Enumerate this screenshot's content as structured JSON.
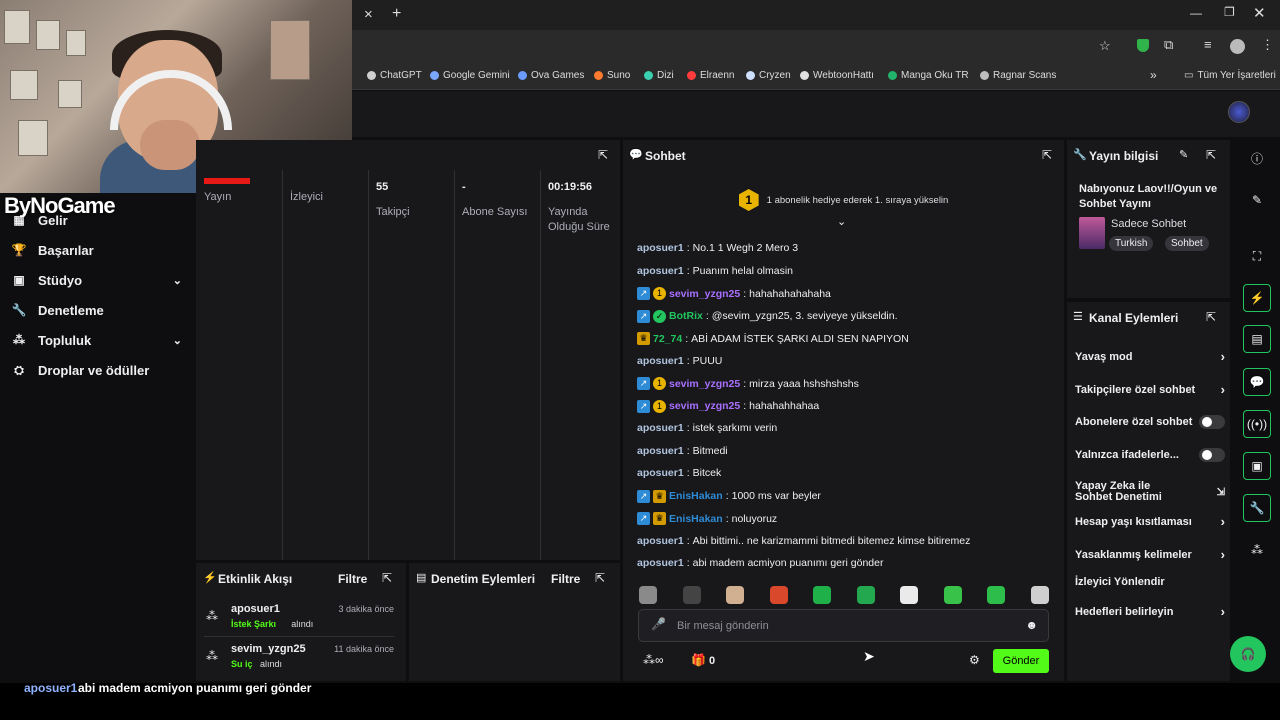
{
  "browser": {
    "close_tab": "×",
    "new_tab": "+",
    "bookmarks": [
      {
        "label": "ChatGPT",
        "color": "#cfcfcf"
      },
      {
        "label": "Google Gemini",
        "color": "#7aa7ff"
      },
      {
        "label": "Ova Games",
        "color": "#6c9cff"
      },
      {
        "label": "Suno",
        "color": "#ff7a2f"
      },
      {
        "label": "Dizi",
        "color": "#3ad0b0"
      },
      {
        "label": "Elraenn",
        "color": "#ff3b3b"
      },
      {
        "label": "Cryzen",
        "color": "#cfe0ff"
      },
      {
        "label": "WebtoonHattı",
        "color": "#e0e0e0"
      },
      {
        "label": "Manga Oku TR",
        "color": "#23b26b"
      },
      {
        "label": "Ragnar Scans",
        "color": "#bdbdbd"
      }
    ],
    "more": "»",
    "all_bookmarks": "Tüm Yer İşaretleri"
  },
  "brand": "ByNoGame",
  "sidebar": {
    "items": [
      {
        "label": "Gelir",
        "icon": "money-icon"
      },
      {
        "label": "Başarılar",
        "icon": "trophy-icon"
      },
      {
        "label": "Stüdyo",
        "icon": "studio-icon",
        "expandable": true
      },
      {
        "label": "Denetleme",
        "icon": "wrench-icon"
      },
      {
        "label": "Topluluk",
        "icon": "community-icon",
        "expandable": true
      },
      {
        "label": "Droplar ve ödüller",
        "icon": "gift-icon"
      }
    ]
  },
  "stats": {
    "columns": [
      {
        "value": "",
        "label": "Yayın"
      },
      {
        "value": "",
        "label": "İzleyici"
      },
      {
        "value": "55",
        "label": "Takipçi"
      },
      {
        "value": "-",
        "label": "Abone Sayısı"
      },
      {
        "value": "00:19:56",
        "label": "Yayında Olduğu Süre"
      }
    ]
  },
  "activity": {
    "title": "Etkinlik Akışı",
    "filter": "Filtre",
    "items": [
      {
        "user": "aposuer1",
        "time": "3 dakika önce",
        "reward": "İstek Şarkı",
        "suffix": "alındı"
      },
      {
        "user": "sevim_yzgn25",
        "time": "11 dakika önce",
        "reward": "Su iç",
        "suffix": "alındı"
      }
    ]
  },
  "modlog": {
    "title": "Denetim Eylemleri",
    "filter": "Filtre"
  },
  "chat": {
    "title": "Sohbet",
    "hype_rank": "1",
    "hype_text": "1 abonelik hediye ederek 1. sıraya yükselin",
    "messages": [
      {
        "user": "aposuer1",
        "text": "No.1 1 Wegh 2 Mero 3",
        "color": "#b0c4de",
        "badges": []
      },
      {
        "user": "aposuer1",
        "text": "Puanım helal olmasin",
        "color": "#b0c4de",
        "badges": []
      },
      {
        "user": "sevim_yzgn25",
        "text": "hahahahahahaha",
        "color": "#a970ff",
        "badges": [
          "vip",
          "sub"
        ]
      },
      {
        "user": "BotRix",
        "text": "@sevim_yzgn25, 3. seviyeye yükseldin.",
        "color": "#22c55e",
        "badges": [
          "vip",
          "bot"
        ]
      },
      {
        "user": "72_74",
        "text": "ABİ ADAM İSTEK ŞARKI ALDI SEN NAPIYON",
        "color": "#22c55e",
        "badges": [
          "crown"
        ]
      },
      {
        "user": "aposuer1",
        "text": "PUUU",
        "color": "#b0c4de",
        "badges": []
      },
      {
        "user": "sevim_yzgn25",
        "text": "mirza yaaa hshshshshs",
        "color": "#a970ff",
        "badges": [
          "vip",
          "sub"
        ]
      },
      {
        "user": "sevim_yzgn25",
        "text": "hahahahhahaa",
        "color": "#a970ff",
        "badges": [
          "vip",
          "sub"
        ]
      },
      {
        "user": "aposuer1",
        "text": "istek şarkımı verin",
        "color": "#b0c4de",
        "badges": []
      },
      {
        "user": "aposuer1",
        "text": "Bitmedi",
        "color": "#b0c4de",
        "badges": []
      },
      {
        "user": "aposuer1",
        "text": "Bitcek",
        "color": "#b0c4de",
        "badges": []
      },
      {
        "user": "EnisHakan",
        "text": "1000 ms var beyler",
        "color": "#2e8bd6",
        "badges": [
          "vip",
          "crown"
        ]
      },
      {
        "user": "EnisHakan",
        "text": "noluyoruz",
        "color": "#2e8bd6",
        "badges": [
          "vip",
          "crown"
        ]
      },
      {
        "user": "aposuer1",
        "text": "Abi bittimi.. ne karizmammi bitmedi bitemez kimse bitiremez",
        "color": "#b0c4de",
        "badges": []
      },
      {
        "user": "aposuer1",
        "text": "abi madem acmiyon puanımı geri gönder",
        "color": "#b0c4de",
        "badges": []
      }
    ],
    "emote_colors": [
      "#8a8a8a",
      "#444",
      "#d0b090",
      "#d9482b",
      "#1fb04a",
      "#24a84f",
      "#eaeaea",
      "#38c24a",
      "#2dbd4a",
      "#cfcfcf"
    ],
    "input_placeholder": "Bir mesaj gönderin",
    "points": "0",
    "send": "Gönder"
  },
  "stream_info": {
    "title_label": "Yayın bilgisi",
    "stream_title": "Nabıyonuz Laov!!/Oyun ve Sohbet Yayını",
    "category": "Sadece Sohbet",
    "tags": [
      "Turkish",
      "Sohbet"
    ]
  },
  "channel_actions": {
    "title": "Kanal Eylemleri",
    "items": [
      {
        "label": "Yavaş mod",
        "control": "chevron"
      },
      {
        "label": "Takipçilere özel sohbet",
        "control": "chevron"
      },
      {
        "label": "Abonelere özel sohbet",
        "control": "toggle"
      },
      {
        "label": "Yalnızca ifadelerle...",
        "control": "toggle"
      },
      {
        "label": "Yapay Zeka ile Sohbet Denetimi",
        "control": "external"
      },
      {
        "label": "Hesap yaşı kısıtlaması",
        "control": "chevron"
      },
      {
        "label": "Yasaklanmış kelimeler",
        "control": "chevron"
      },
      {
        "label": "İzleyici Yönlendir",
        "control": "none"
      },
      {
        "label": "Hedefleri belirleyin",
        "control": "chevron"
      }
    ]
  },
  "caption": {
    "user": "aposuer1",
    "text": "abi madem acmiyon puanımı geri gönder"
  },
  "accent": "#53fc18"
}
